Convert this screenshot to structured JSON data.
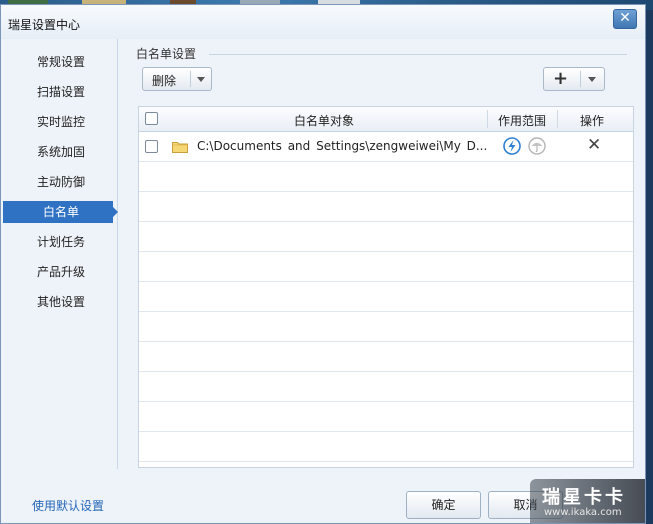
{
  "window": {
    "title": "瑞星设置中心",
    "close_glyph": "✕"
  },
  "sidebar": {
    "items": [
      {
        "label": "常规设置"
      },
      {
        "label": "扫描设置"
      },
      {
        "label": "实时监控"
      },
      {
        "label": "系统加固"
      },
      {
        "label": "主动防御"
      },
      {
        "label": "白名单",
        "active": true
      },
      {
        "label": "计划任务"
      },
      {
        "label": "产品升级"
      },
      {
        "label": "其他设置"
      }
    ]
  },
  "section": {
    "title": "白名单设置"
  },
  "toolbar": {
    "delete_label": "删除",
    "add_glyph": "+"
  },
  "table": {
    "columns": [
      "白名单对象",
      "作用范围",
      "操作"
    ],
    "rows": [
      {
        "path": "C:\\Documents and Settings\\zengweiwei\\My D...",
        "scope_icons": [
          "lightning-icon",
          "umbrella-icon"
        ],
        "action_glyph": "✕"
      }
    ]
  },
  "footer": {
    "default_link": "使用默认设置",
    "ok_label": "确定",
    "cancel_label": "取消"
  },
  "watermark": {
    "brand": "瑞星卡卡",
    "url": "www.ikaka.com"
  },
  "colors": {
    "accent": "#2f72c4",
    "link": "#2566b8"
  }
}
